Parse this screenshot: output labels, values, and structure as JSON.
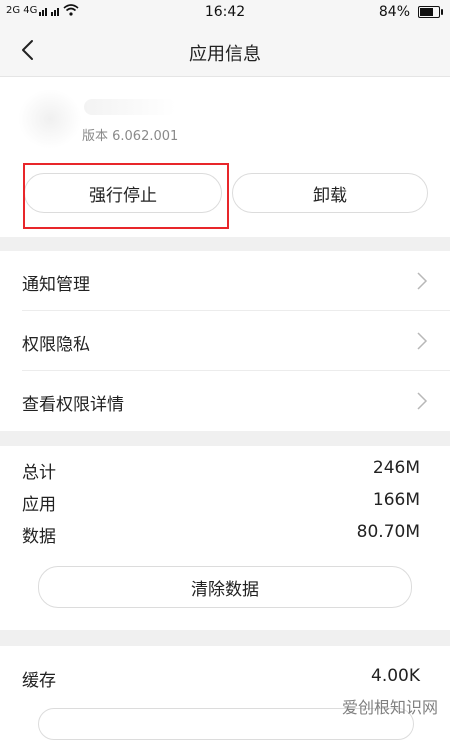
{
  "status_bar": {
    "signal_left": "2G 4G",
    "time": "16:42",
    "battery_text": "84%",
    "battery_level": 0.84
  },
  "header": {
    "title": "应用信息"
  },
  "app": {
    "version": "版本 6.062.001"
  },
  "buttons": {
    "force_stop": "强行停止",
    "uninstall": "卸载"
  },
  "menu": [
    {
      "label": "通知管理"
    },
    {
      "label": "权限隐私"
    },
    {
      "label": "查看权限详情"
    }
  ],
  "storage": {
    "total_label": "总计",
    "total_value": "246M",
    "app_label": "应用",
    "app_value": "166M",
    "data_label": "数据",
    "data_value": "80.70M",
    "clear_label": "清除数据"
  },
  "cache": {
    "label": "缓存",
    "value": "4.00K"
  },
  "watermark": "爱创根知识网",
  "colors": {
    "highlight": "#e8262a",
    "separator": "#f0f0f0"
  }
}
